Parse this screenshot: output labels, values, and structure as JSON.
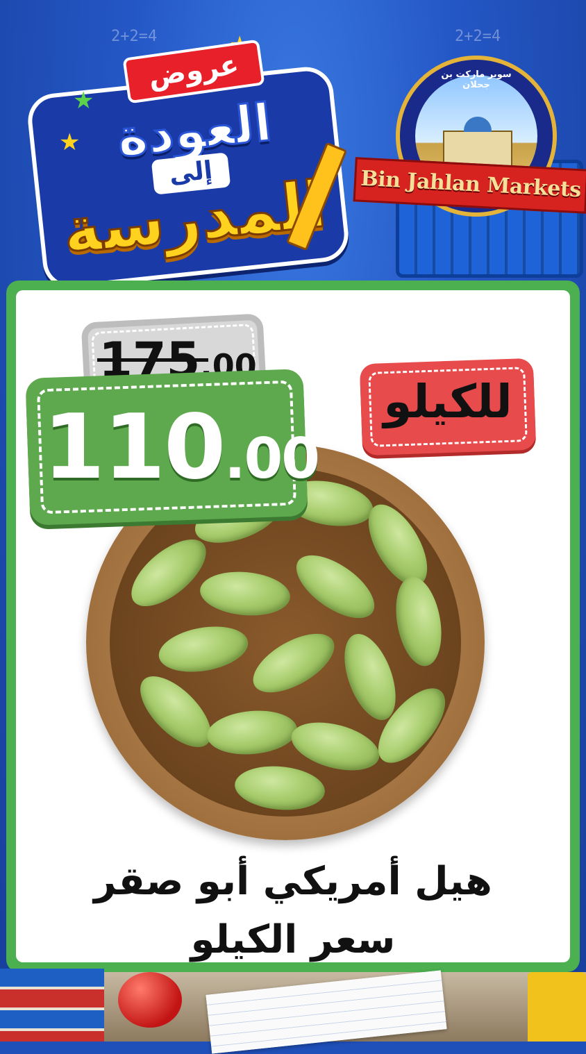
{
  "header": {
    "offers_label": "عروض",
    "promo_line1": "العودة",
    "promo_line2": "إلى",
    "promo_line3": "المدرسة",
    "doodle_equation": "2+2=4"
  },
  "logo": {
    "arabic_name": "سوبر ماركت بن جحلان",
    "english_name": "Bin Jahlan Markets"
  },
  "offer": {
    "old_price_int": "175",
    "old_price_dec": ".00",
    "new_price_int": "110",
    "new_price_dec": ".00",
    "unit_label": "للكيلو"
  },
  "product": {
    "name_line1": "هيل أمريكي أبو صقر",
    "name_line2": "سعر الكيلو"
  },
  "colors": {
    "card_border": "#4caf50",
    "new_price_tag": "#5ea84e",
    "old_price_tag": "#d8d8d8",
    "unit_tag": "#e84b4b",
    "background": "#2457c6"
  }
}
